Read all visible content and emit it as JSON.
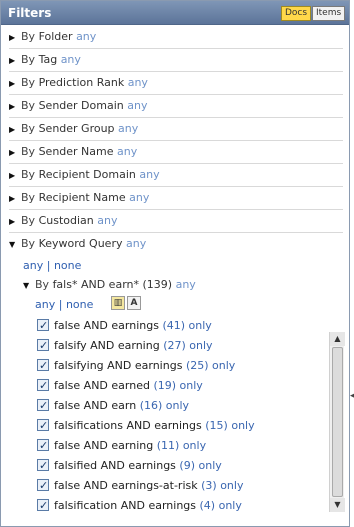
{
  "header": {
    "title": "Filters",
    "docs_label": "Docs",
    "items_label": "Items"
  },
  "facets": [
    {
      "by": "By",
      "label": "Folder",
      "any": "any"
    },
    {
      "by": "By",
      "label": "Tag",
      "any": "any"
    },
    {
      "by": "By",
      "label": "Prediction Rank",
      "any": "any"
    },
    {
      "by": "By",
      "label": "Sender Domain",
      "any": "any"
    },
    {
      "by": "By",
      "label": "Sender Group",
      "any": "any"
    },
    {
      "by": "By",
      "label": "Sender Name",
      "any": "any"
    },
    {
      "by": "By",
      "label": "Recipient Domain",
      "any": "any"
    },
    {
      "by": "By",
      "label": "Recipient Name",
      "any": "any"
    },
    {
      "by": "By",
      "label": "Custodian",
      "any": "any"
    },
    {
      "by": "By",
      "label": "Keyword Query",
      "any": "any"
    }
  ],
  "keyword_query": {
    "any": "any",
    "sep": "|",
    "none": "none",
    "sub": {
      "by": "By",
      "label": "fals* AND earn*",
      "count": "(139)",
      "any": "any"
    },
    "sub_links": {
      "any": "any",
      "sep": "|",
      "none": "none"
    },
    "tools": {
      "t1": "▥",
      "t2": "A"
    }
  },
  "terms": [
    {
      "term": "false AND earnings",
      "count": "(41)",
      "only": "only"
    },
    {
      "term": "falsify AND earning",
      "count": "(27)",
      "only": "only"
    },
    {
      "term": "falsifying AND earnings",
      "count": "(25)",
      "only": "only"
    },
    {
      "term": "false AND earned",
      "count": "(19)",
      "only": "only"
    },
    {
      "term": "false AND earn",
      "count": "(16)",
      "only": "only"
    },
    {
      "term": "falsifications AND earnings",
      "count": "(15)",
      "only": "only"
    },
    {
      "term": "false AND earning",
      "count": "(11)",
      "only": "only"
    },
    {
      "term": "falsified AND earnings",
      "count": "(9)",
      "only": "only"
    },
    {
      "term": "false AND earnings-at-risk",
      "count": "(3)",
      "only": "only"
    },
    {
      "term": "falsification AND earnings",
      "count": "(4)",
      "only": "only"
    }
  ],
  "icons": {
    "collapsed": "triangle-right-icon",
    "expanded": "triangle-down-icon",
    "checkbox": "checkbox-checked-icon",
    "scroll_up": "scroll-up-arrow-icon",
    "scroll_down": "scroll-down-arrow-icon",
    "edge": "panel-resize-arrow-icon"
  },
  "colors": {
    "header": "#6b82a6",
    "docs_active": "#ffd84a",
    "link": "#2f5fb0",
    "any": "#6f93c9"
  }
}
